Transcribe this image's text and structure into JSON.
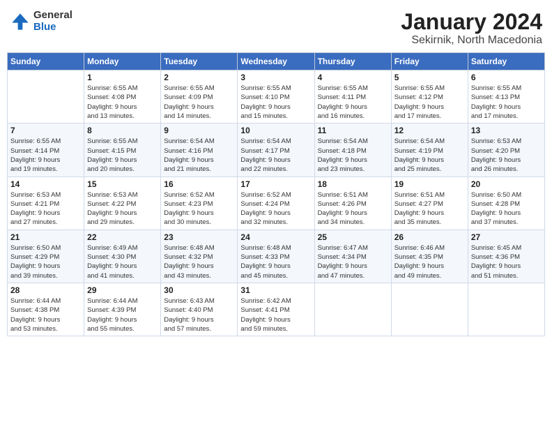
{
  "logo": {
    "general": "General",
    "blue": "Blue"
  },
  "title": "January 2024",
  "subtitle": "Sekirnik, North Macedonia",
  "headers": [
    "Sunday",
    "Monday",
    "Tuesday",
    "Wednesday",
    "Thursday",
    "Friday",
    "Saturday"
  ],
  "weeks": [
    [
      {
        "day": "",
        "info": ""
      },
      {
        "day": "1",
        "info": "Sunrise: 6:55 AM\nSunset: 4:08 PM\nDaylight: 9 hours\nand 13 minutes."
      },
      {
        "day": "2",
        "info": "Sunrise: 6:55 AM\nSunset: 4:09 PM\nDaylight: 9 hours\nand 14 minutes."
      },
      {
        "day": "3",
        "info": "Sunrise: 6:55 AM\nSunset: 4:10 PM\nDaylight: 9 hours\nand 15 minutes."
      },
      {
        "day": "4",
        "info": "Sunrise: 6:55 AM\nSunset: 4:11 PM\nDaylight: 9 hours\nand 16 minutes."
      },
      {
        "day": "5",
        "info": "Sunrise: 6:55 AM\nSunset: 4:12 PM\nDaylight: 9 hours\nand 17 minutes."
      },
      {
        "day": "6",
        "info": "Sunrise: 6:55 AM\nSunset: 4:13 PM\nDaylight: 9 hours\nand 17 minutes."
      }
    ],
    [
      {
        "day": "7",
        "info": "Sunrise: 6:55 AM\nSunset: 4:14 PM\nDaylight: 9 hours\nand 19 minutes."
      },
      {
        "day": "8",
        "info": "Sunrise: 6:55 AM\nSunset: 4:15 PM\nDaylight: 9 hours\nand 20 minutes."
      },
      {
        "day": "9",
        "info": "Sunrise: 6:54 AM\nSunset: 4:16 PM\nDaylight: 9 hours\nand 21 minutes."
      },
      {
        "day": "10",
        "info": "Sunrise: 6:54 AM\nSunset: 4:17 PM\nDaylight: 9 hours\nand 22 minutes."
      },
      {
        "day": "11",
        "info": "Sunrise: 6:54 AM\nSunset: 4:18 PM\nDaylight: 9 hours\nand 23 minutes."
      },
      {
        "day": "12",
        "info": "Sunrise: 6:54 AM\nSunset: 4:19 PM\nDaylight: 9 hours\nand 25 minutes."
      },
      {
        "day": "13",
        "info": "Sunrise: 6:53 AM\nSunset: 4:20 PM\nDaylight: 9 hours\nand 26 minutes."
      }
    ],
    [
      {
        "day": "14",
        "info": "Sunrise: 6:53 AM\nSunset: 4:21 PM\nDaylight: 9 hours\nand 27 minutes."
      },
      {
        "day": "15",
        "info": "Sunrise: 6:53 AM\nSunset: 4:22 PM\nDaylight: 9 hours\nand 29 minutes."
      },
      {
        "day": "16",
        "info": "Sunrise: 6:52 AM\nSunset: 4:23 PM\nDaylight: 9 hours\nand 30 minutes."
      },
      {
        "day": "17",
        "info": "Sunrise: 6:52 AM\nSunset: 4:24 PM\nDaylight: 9 hours\nand 32 minutes."
      },
      {
        "day": "18",
        "info": "Sunrise: 6:51 AM\nSunset: 4:26 PM\nDaylight: 9 hours\nand 34 minutes."
      },
      {
        "day": "19",
        "info": "Sunrise: 6:51 AM\nSunset: 4:27 PM\nDaylight: 9 hours\nand 35 minutes."
      },
      {
        "day": "20",
        "info": "Sunrise: 6:50 AM\nSunset: 4:28 PM\nDaylight: 9 hours\nand 37 minutes."
      }
    ],
    [
      {
        "day": "21",
        "info": "Sunrise: 6:50 AM\nSunset: 4:29 PM\nDaylight: 9 hours\nand 39 minutes."
      },
      {
        "day": "22",
        "info": "Sunrise: 6:49 AM\nSunset: 4:30 PM\nDaylight: 9 hours\nand 41 minutes."
      },
      {
        "day": "23",
        "info": "Sunrise: 6:48 AM\nSunset: 4:32 PM\nDaylight: 9 hours\nand 43 minutes."
      },
      {
        "day": "24",
        "info": "Sunrise: 6:48 AM\nSunset: 4:33 PM\nDaylight: 9 hours\nand 45 minutes."
      },
      {
        "day": "25",
        "info": "Sunrise: 6:47 AM\nSunset: 4:34 PM\nDaylight: 9 hours\nand 47 minutes."
      },
      {
        "day": "26",
        "info": "Sunrise: 6:46 AM\nSunset: 4:35 PM\nDaylight: 9 hours\nand 49 minutes."
      },
      {
        "day": "27",
        "info": "Sunrise: 6:45 AM\nSunset: 4:36 PM\nDaylight: 9 hours\nand 51 minutes."
      }
    ],
    [
      {
        "day": "28",
        "info": "Sunrise: 6:44 AM\nSunset: 4:38 PM\nDaylight: 9 hours\nand 53 minutes."
      },
      {
        "day": "29",
        "info": "Sunrise: 6:44 AM\nSunset: 4:39 PM\nDaylight: 9 hours\nand 55 minutes."
      },
      {
        "day": "30",
        "info": "Sunrise: 6:43 AM\nSunset: 4:40 PM\nDaylight: 9 hours\nand 57 minutes."
      },
      {
        "day": "31",
        "info": "Sunrise: 6:42 AM\nSunset: 4:41 PM\nDaylight: 9 hours\nand 59 minutes."
      },
      {
        "day": "",
        "info": ""
      },
      {
        "day": "",
        "info": ""
      },
      {
        "day": "",
        "info": ""
      }
    ]
  ]
}
